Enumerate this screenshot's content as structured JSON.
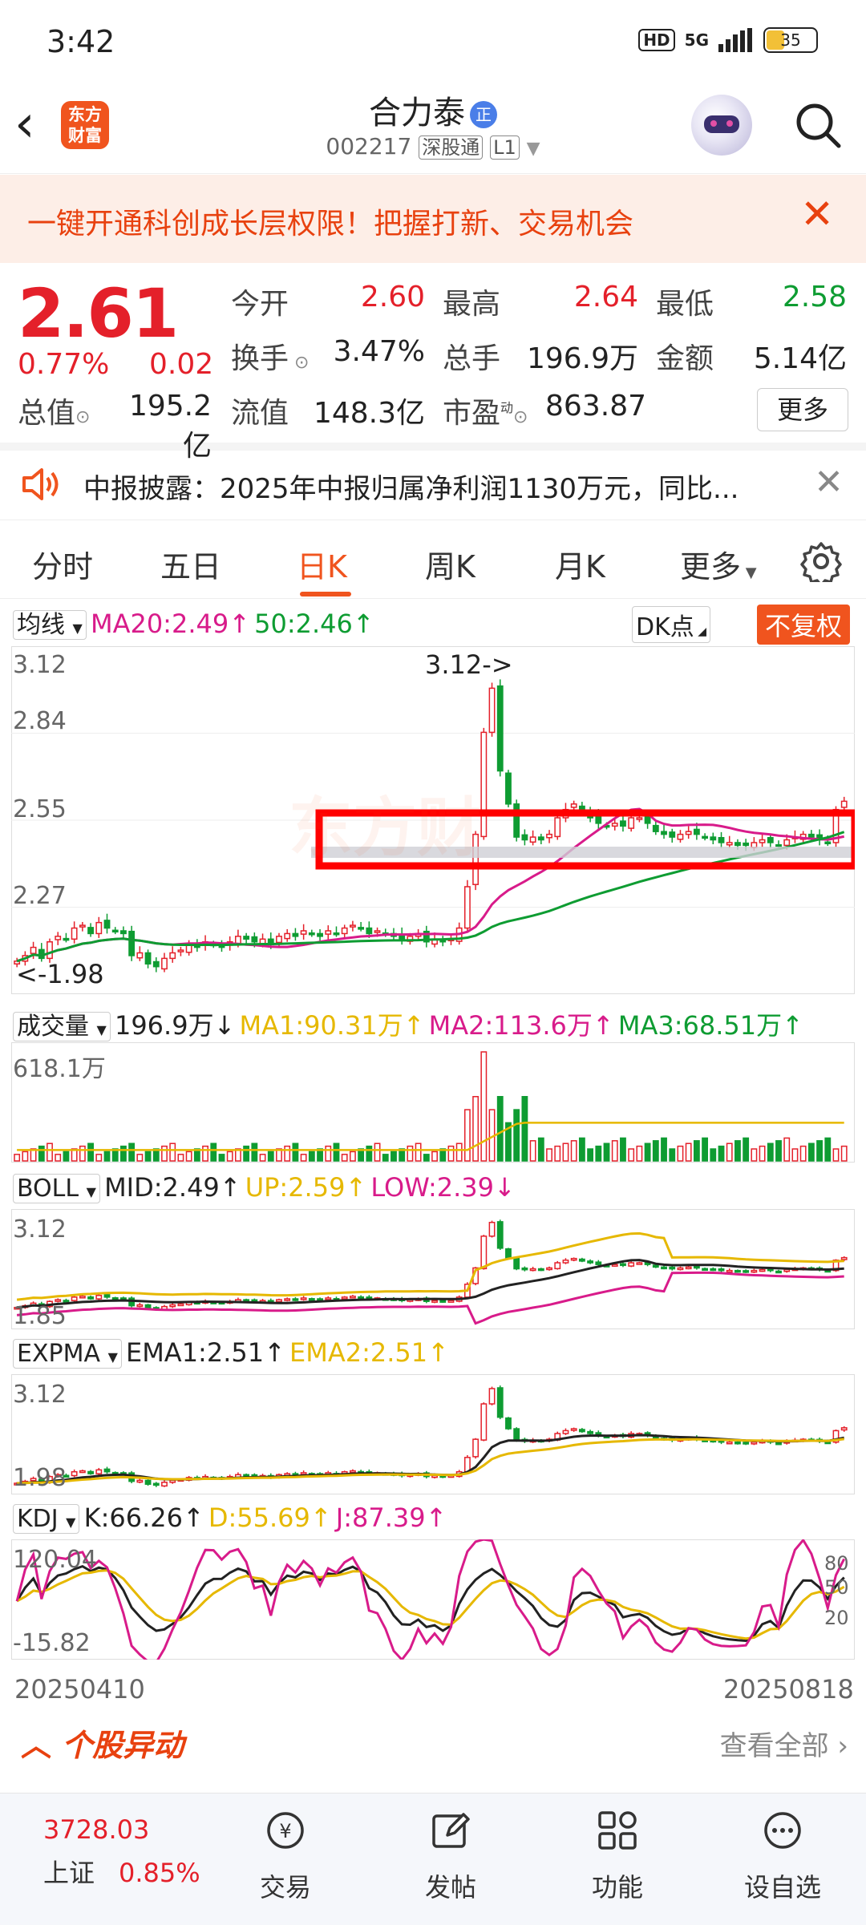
{
  "status_bar": {
    "time": "3:42",
    "hd": "HD",
    "network": "5G",
    "battery": "35"
  },
  "header": {
    "logo_text": "东方财富",
    "title": "合力泰",
    "title_badge": "正",
    "code": "002217",
    "tag_connect": "深股通",
    "tag_level": "L1"
  },
  "banner": {
    "text": "一键开通科创成长层权限！把握打新、交易机会"
  },
  "quote": {
    "price": "2.61",
    "pct": "0.77%",
    "change": "0.02",
    "open_label": "今开",
    "open": "2.60",
    "high_label": "最高",
    "high": "2.64",
    "low_label": "最低",
    "low": "2.58",
    "turnover_label": "换手",
    "turnover": "3.47%",
    "volume_label": "总手",
    "volume": "196.9万",
    "amount_label": "金额",
    "amount": "5.14亿",
    "mktcap_label": "总值",
    "mktcap": "195.2亿",
    "float_label": "流值",
    "float": "148.3亿",
    "pe_label": "市盈",
    "pe_sup": "动",
    "pe": "863.87",
    "more_label": "更多"
  },
  "notice": {
    "text": "中报披露：2025年中报归属净利润1130万元，同比..."
  },
  "tabs": [
    "分时",
    "五日",
    "日K",
    "周K",
    "月K",
    "更多"
  ],
  "active_tab": "日K",
  "chart": {
    "ma_selector": "均线",
    "ma20": "MA20:2.49",
    "ma50": "50:2.46",
    "dk_label": "DK点",
    "adjust_label": "不复权",
    "price_ticks": [
      "3.12",
      "2.84",
      "2.55",
      "2.27",
      "1.98"
    ],
    "max_annot": "3.12->",
    "min_annot": "<-1.98",
    "watermark": "东方财",
    "vol_selector": "成交量",
    "vol_value": "196.9万",
    "vol_ma1": "MA1:90.31万",
    "vol_ma2": "MA2:113.6万",
    "vol_ma3": "MA3:68.51万",
    "vol_max": "618.1万",
    "boll_selector": "BOLL",
    "boll_mid": "MID:2.49",
    "boll_up": "UP:2.59",
    "boll_low": "LOW:2.39",
    "boll_top": "3.12",
    "boll_bottom": "1.85",
    "expma_selector": "EXPMA",
    "ema1": "EMA1:2.51",
    "ema2": "EMA2:2.51",
    "expma_top": "3.12",
    "expma_bottom": "1.98",
    "kdj_selector": "KDJ",
    "kdj_k": "K:66.26",
    "kdj_d": "D:55.69",
    "kdj_j": "J:87.39",
    "kdj_top": "120.04",
    "kdj_bottom": "-15.82",
    "kdj_80": "80",
    "kdj_50": "50",
    "kdj_20": "20",
    "date_start": "20250410",
    "date_end": "20250818",
    "colors": {
      "up": "#e4202a",
      "down": "#0e9c32",
      "ma20": "#d81b8a",
      "ma50": "#0e9c32",
      "yellow": "#e6b800",
      "mid": "#222222"
    }
  },
  "chart_data": {
    "type": "candlestick",
    "x_start": "20250410",
    "x_end": "20250818",
    "price_range": [
      1.98,
      3.12
    ],
    "close": [
      2.03,
      2.05,
      2.08,
      2.04,
      2.1,
      2.12,
      2.11,
      2.15,
      2.16,
      2.13,
      2.17,
      2.15,
      2.14,
      2.13,
      2.05,
      2.06,
      2.02,
      2.01,
      2.04,
      2.06,
      2.07,
      2.09,
      2.08,
      2.1,
      2.09,
      2.08,
      2.1,
      2.12,
      2.11,
      2.1,
      2.11,
      2.09,
      2.12,
      2.13,
      2.12,
      2.14,
      2.13,
      2.12,
      2.14,
      2.13,
      2.15,
      2.16,
      2.15,
      2.13,
      2.14,
      2.13,
      2.12,
      2.11,
      2.12,
      2.13,
      2.1,
      2.11,
      2.1,
      2.11,
      2.15,
      2.3,
      2.49,
      2.86,
      3.02,
      2.72,
      2.6,
      2.48,
      2.47,
      2.48,
      2.47,
      2.49,
      2.55,
      2.58,
      2.6,
      2.57,
      2.55,
      2.53,
      2.52,
      2.53,
      2.52,
      2.55,
      2.55,
      2.53,
      2.5,
      2.49,
      2.48,
      2.49,
      2.5,
      2.49,
      2.48,
      2.47,
      2.46,
      2.46,
      2.45,
      2.45,
      2.46,
      2.47,
      2.46,
      2.45,
      2.47,
      2.48,
      2.49,
      2.48,
      2.47,
      2.46,
      2.58,
      2.61
    ]
  },
  "yidong": {
    "title": "个股异动",
    "view_all": "查看全部"
  },
  "nav": {
    "index_value": "3728.03",
    "index_name": "上证",
    "index_pct": "0.85%",
    "items": [
      "交易",
      "发帖",
      "功能",
      "设自选"
    ]
  }
}
